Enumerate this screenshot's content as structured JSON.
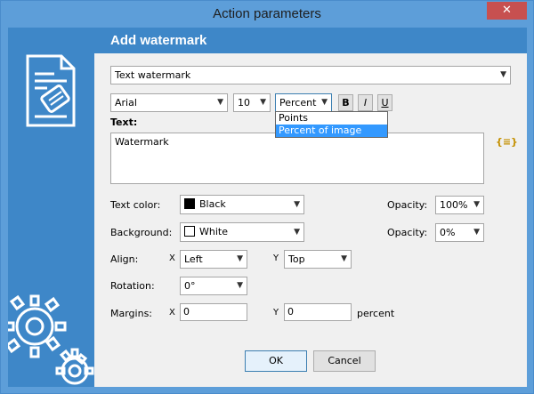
{
  "window": {
    "title": "Action parameters",
    "close_glyph": "✕"
  },
  "header": {
    "title": "Add watermark"
  },
  "watermark_type": {
    "value": "Text watermark"
  },
  "font": {
    "family": "Arial",
    "size": "10",
    "unit": "Percent",
    "unit_options": [
      "Points",
      "Percent of image height"
    ],
    "unit_highlighted": "Percent of image height",
    "bold_label": "B",
    "italic_label": "I",
    "underline_label": "U"
  },
  "text": {
    "label": "Text:",
    "value": "Watermark",
    "insert_icon_glyph": "{≡}"
  },
  "text_color": {
    "label": "Text color:",
    "value": "Black",
    "swatch": "#000000",
    "opacity_label": "Opacity:",
    "opacity": "100%"
  },
  "background": {
    "label": "Background:",
    "value": "White",
    "swatch": "#ffffff",
    "opacity_label": "Opacity:",
    "opacity": "0%"
  },
  "align": {
    "label": "Align:",
    "x_axis": "X",
    "x": "Left",
    "y_axis": "Y",
    "y": "Top"
  },
  "rotation": {
    "label": "Rotation:",
    "value": "0°"
  },
  "margins": {
    "label": "Margins:",
    "x_axis": "X",
    "x": "0",
    "y_axis": "Y",
    "y": "0",
    "unit": "percent"
  },
  "buttons": {
    "ok": "OK",
    "cancel": "Cancel"
  },
  "colors": {
    "frame": "#5d9ed9",
    "header": "#3e87c8",
    "selection": "#3399ff",
    "close": "#c75050"
  }
}
